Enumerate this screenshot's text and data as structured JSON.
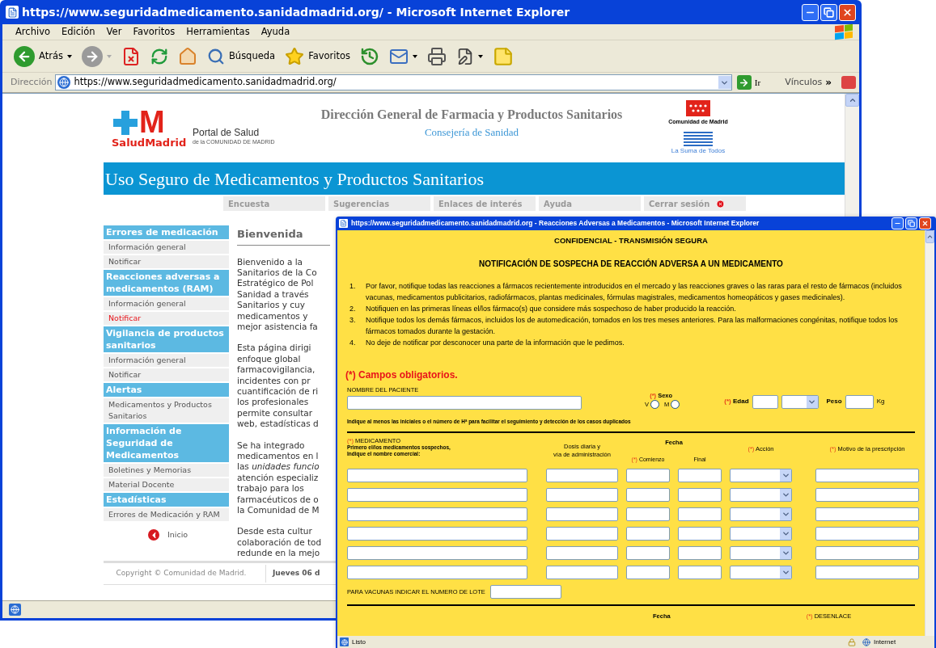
{
  "browser": {
    "title": "https://www.seguridadmedicamento.sanidadmadrid.org/ - Microsoft Internet Explorer",
    "menu": [
      "Archivo",
      "Edición",
      "Ver",
      "Favoritos",
      "Herramientas",
      "Ayuda"
    ],
    "toolbar": [
      {
        "kind": "back",
        "label": "Atrás",
        "menu": true,
        "disabled": false
      },
      {
        "kind": "forward",
        "menu": true,
        "disabled": true
      },
      {
        "kind": "stop",
        "menu": false,
        "disabled": false
      },
      {
        "kind": "refresh",
        "menu": false,
        "disabled": false
      },
      {
        "kind": "home",
        "menu": false,
        "disabled": false
      },
      {
        "kind": "search",
        "label": "Búsqueda",
        "menu": false,
        "disabled": false
      },
      {
        "kind": "favorites",
        "label": "Favoritos",
        "menu": false,
        "disabled": false
      },
      {
        "kind": "history",
        "menu": false,
        "disabled": false
      },
      {
        "kind": "mail",
        "menu": true,
        "disabled": false
      },
      {
        "kind": "print",
        "menu": false,
        "disabled": false
      },
      {
        "kind": "edit",
        "menu": true,
        "disabled": false
      },
      {
        "kind": "note",
        "menu": false,
        "disabled": false
      }
    ],
    "address": {
      "label": "Dirección",
      "value": "https://www.seguridadmedicamento.sanidadmadrid.org/",
      "go": "Ir",
      "links": "Vínculos",
      "more": "»"
    }
  },
  "page": {
    "logo": {
      "letter": "M",
      "name": "SaludMadrid",
      "portal": "Portal de Salud",
      "portal_sub": "de la COMUNIDAD DE MADRID"
    },
    "heading": "Dirección General de Farmacia y Productos Sanitarios",
    "subheading": "Consejería de Sanidad",
    "region": "Comunidad de Madrid",
    "slogan": "La Suma de Todos",
    "banner": "Uso Seguro de Medicamentos y Productos Sanitarios",
    "nav": [
      {
        "label": "Encuesta",
        "kind": "link"
      },
      {
        "label": "Sugerencias",
        "kind": "link"
      },
      {
        "label": "Enlaces de interés",
        "kind": "link"
      },
      {
        "label": "Ayuda",
        "kind": "link"
      },
      {
        "label": "Cerrar sesión",
        "kind": "logout"
      }
    ],
    "sidebar": [
      {
        "title": "Errores de medicación",
        "items": [
          {
            "label": "Información general",
            "selected": false
          },
          {
            "label": "Notificar",
            "selected": false
          }
        ]
      },
      {
        "title": "Reacciones adversas a medicamentos (RAM)",
        "items": [
          {
            "label": "Información general",
            "selected": false
          },
          {
            "label": "Notificar",
            "selected": true
          }
        ]
      },
      {
        "title": "Vigilancia de productos sanitarios",
        "items": [
          {
            "label": "Información general",
            "selected": false
          },
          {
            "label": "Notificar",
            "selected": false
          }
        ]
      },
      {
        "title": "Alertas",
        "items": [
          {
            "label": "Medicamentos y Productos Sanitarios",
            "selected": false
          }
        ]
      },
      {
        "title": "Información de Seguridad de Medicamentos",
        "items": [
          {
            "label": "Boletines y Memorias",
            "selected": false
          },
          {
            "label": "Material Docente",
            "selected": false
          }
        ]
      },
      {
        "title": "Estadísticas",
        "items": [
          {
            "label": "Errores de Medicación y RAM",
            "selected": false
          }
        ]
      }
    ],
    "home_link": "Inicio",
    "article": {
      "title": "Bienvenida",
      "paragraphs": [
        [
          "Bienvenido a la",
          "Sanitarios de la Co",
          "Estratégico de Pol",
          "Sanidad a través",
          "Sanitarios y cuy",
          "medicamentos y",
          "mejor asistencia fa"
        ],
        [
          "Esta página dirigi",
          "enfoque global",
          "farmacovigilancia,",
          "incidentes con pr",
          "cuantificación de ri",
          "los profesionales",
          "permite consultar",
          "web, estadísticas d"
        ],
        [
          "Se ha integrado",
          "medicamentos en l",
          "las *unidades funcio*",
          "atención especializ",
          "trabajo para los",
          "farmacéuticos de o",
          "la Comunidad de M"
        ],
        [
          "Desde esta cultur",
          "colaboración de tod",
          "redunde en la mejo"
        ]
      ]
    },
    "footer": {
      "copyright": "Copyright © Comunidad de Madrid.",
      "date": "Jueves 06 d"
    }
  },
  "popup": {
    "title": "https://www.seguridadmedicamento.sanidadmadrid.org - Reacciones Adversas a Medicamentos - Microsoft Internet Explorer",
    "confidential": "CONFIDENCIAL - TRANSMISIÓN SEGURA",
    "heading": "NOTIFICACIÓN DE SOSPECHA DE REACCIÓN ADVERSA A UN MEDICAMENTO",
    "instructions": [
      {
        "number": "1.",
        "text": "Por favor, notifique todas las reacciones a fármacos recientemente introducidos en el mercado y las reacciones graves o las raras para el resto de fármacos (incluidos vacunas, medicamentos publicitarios, radiofármacos, plantas medicinales, fórmulas magistrales, medicamentos homeopáticos y gases medicinales)."
      },
      {
        "number": "2.",
        "text": "Notifiquen en las primeras líneas el/los fármaco(s) que considere más sospechoso de haber producido la reacción."
      },
      {
        "number": "3.",
        "text": "Notifique todos los demás fármacos, incluidos los de automedicación, tomados en los tres meses anteriores. Para las malformaciones congénitas, notifique todos los fármacos tomados durante la gestación."
      },
      {
        "number": "4.",
        "text": "No deje de notificar por desconocer una parte de la información que le pedimos."
      }
    ],
    "legend": "(*) Campos obligatorios.",
    "patient": {
      "name_label": "NOMBRE DEL PACIENTE",
      "sex": {
        "mark": "(*)",
        "label": "Sexo",
        "options": [
          {
            "label": "V",
            "selected": false
          },
          {
            "label": "M",
            "selected": false
          }
        ]
      },
      "age": {
        "mark": "(*)",
        "label": "Edad"
      },
      "weight": {
        "label": "Peso",
        "unit": "Kg"
      }
    },
    "hint": "Indique al menos las iniciales o el número de Hª para facilitar el seguimiento y detección de los casos duplicados",
    "medication": {
      "drug": {
        "mark": "(*)",
        "label": "MEDICAMENTO",
        "notes": [
          "Primero el/los medicamentos sospechos,",
          "Indique el nombre comercial:"
        ]
      },
      "dose": [
        "Dosis diaria y",
        "vía de administración"
      ],
      "date": {
        "label": "Fecha",
        "start": {
          "mark": "(*)",
          "label": "Comienzo"
        },
        "end": "Final"
      },
      "action": {
        "mark": "(*)",
        "label": "Acción"
      },
      "reason": {
        "mark": "(*)",
        "label": "Motivo de la prescripción"
      },
      "rows": [
        {
          "kind": "entry"
        },
        {
          "kind": "entry"
        },
        {
          "kind": "entry"
        },
        {
          "kind": "entry"
        },
        {
          "kind": "entry"
        },
        {
          "kind": "entry"
        }
      ]
    },
    "lot": "PARA VACUNAS INDICAR EL NUMERO DE LOTE",
    "next": {
      "date": "Fecha",
      "outcome": {
        "mark": "(*)",
        "label": "DESENLACE"
      }
    },
    "status": {
      "text": "Listo",
      "zone": "Internet"
    }
  }
}
